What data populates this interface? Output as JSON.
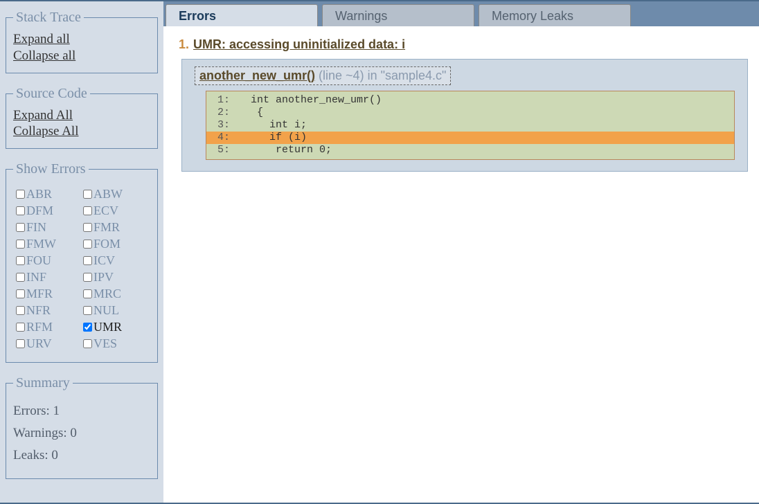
{
  "sidebar": {
    "stackTrace": {
      "legend": "Stack Trace",
      "expandAll": "Expand all",
      "collapseAll": "Collapse all"
    },
    "sourceCode": {
      "legend": "Source Code",
      "expandAll": "Expand All",
      "collapseAll": "Collapse All"
    },
    "showErrors": {
      "legend": "Show Errors",
      "items": [
        {
          "code": "ABR",
          "checked": false
        },
        {
          "code": "ABW",
          "checked": false
        },
        {
          "code": "DFM",
          "checked": false
        },
        {
          "code": "ECV",
          "checked": false
        },
        {
          "code": "FIN",
          "checked": false
        },
        {
          "code": "FMR",
          "checked": false
        },
        {
          "code": "FMW",
          "checked": false
        },
        {
          "code": "FOM",
          "checked": false
        },
        {
          "code": "FOU",
          "checked": false
        },
        {
          "code": "ICV",
          "checked": false
        },
        {
          "code": "INF",
          "checked": false
        },
        {
          "code": "IPV",
          "checked": false
        },
        {
          "code": "MFR",
          "checked": false
        },
        {
          "code": "MRC",
          "checked": false
        },
        {
          "code": "NFR",
          "checked": false
        },
        {
          "code": "NUL",
          "checked": false
        },
        {
          "code": "RFM",
          "checked": false
        },
        {
          "code": "UMR",
          "checked": true
        },
        {
          "code": "URV",
          "checked": false
        },
        {
          "code": "VES",
          "checked": false
        }
      ]
    },
    "summary": {
      "legend": "Summary",
      "errors": "Errors: 1",
      "warnings": "Warnings: 0",
      "leaks": "Leaks: 0"
    }
  },
  "tabs": [
    {
      "label": "Errors",
      "active": true
    },
    {
      "label": "Warnings",
      "active": false
    },
    {
      "label": "Memory Leaks",
      "active": false
    }
  ],
  "errors": [
    {
      "num": "1.",
      "title": "UMR: accessing uninitialized data: i",
      "frame": {
        "fn": "another_new_umr()",
        "loc": " (line ~4) in \"sample4.c\""
      },
      "code": [
        {
          "n": "1:",
          "text": "  int another_new_umr()",
          "hl": false
        },
        {
          "n": "2:",
          "text": "   {",
          "hl": false
        },
        {
          "n": "3:",
          "text": "     int i;",
          "hl": false
        },
        {
          "n": "4:",
          "text": "     if (i)",
          "hl": true
        },
        {
          "n": "5:",
          "text": "      return 0;",
          "hl": false
        }
      ]
    }
  ]
}
